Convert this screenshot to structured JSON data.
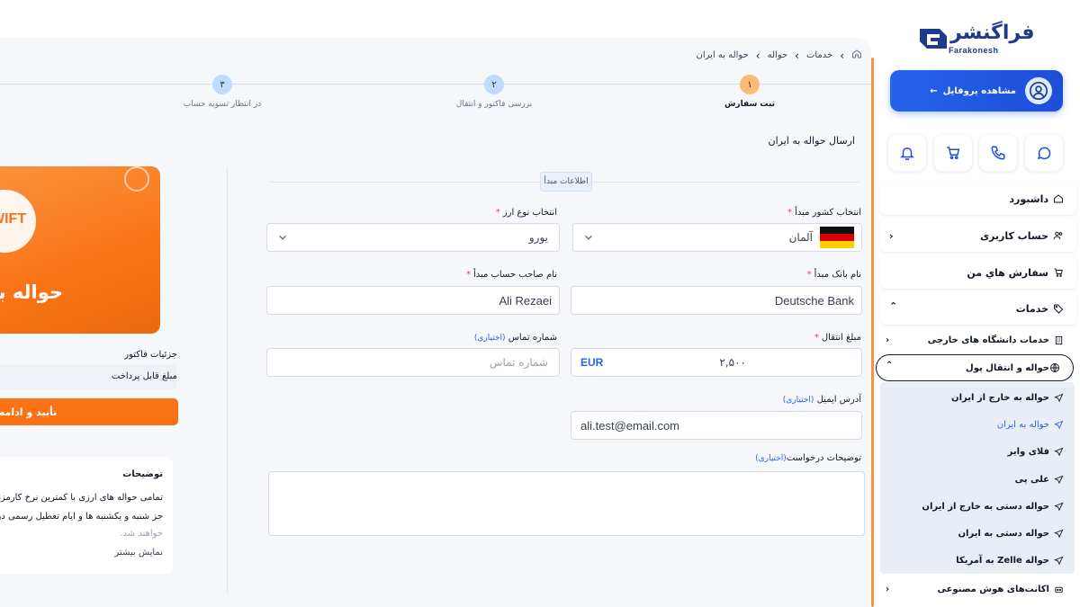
{
  "breadcrumb": {
    "home": "",
    "services": "خدمات",
    "remittance": "حواله",
    "current": "حواله به ایران"
  },
  "steps": [
    {
      "num": "۱",
      "label": "ثبت سفارش",
      "color": "#fdba74"
    },
    {
      "num": "۲",
      "label": "بررسی فاکتور و انتقال",
      "color": "#bfdbfe"
    },
    {
      "num": "۳",
      "label": "در انتظار تسویه حساب",
      "color": "#bfdbfe"
    }
  ],
  "form": {
    "title": "ارسال حواله به ایران",
    "section_label": "اطلاعات مبدأ",
    "origin_country_label": "انتخاب کشور مبدأ",
    "origin_country_value": "آلمان",
    "currency_label": "انتخاب نوع ارز",
    "currency_value": "یورو",
    "bank_label": "نام بانک مبدأ",
    "bank_value": "Deutsche Bank",
    "holder_label": "نام صاحب حساب مبدأ",
    "holder_value": "Ali Rezaei",
    "amount_label": "مبلغ انتقال",
    "amount_value": "۲,۵۰۰",
    "amount_currency": "EUR",
    "phone_label": "شماره تماس",
    "phone_optional": "(اختیاری)",
    "phone_placeholder": "شماره تماس",
    "email_label": "آدرس ایمیل",
    "email_optional": "(اختیاری)",
    "email_value": "ali.test@email.com",
    "notes_label": "توضیحات درخواست",
    "notes_optional": "(اختیاری)",
    "required_mark": "*"
  },
  "invoice": {
    "banner_swift": "WIFT",
    "banner_title": "حواله به",
    "details_label": "جزئیات فاکتور",
    "payable_label": "مبلغ قابل پرداخت",
    "confirm_button": "تأیید و ادامه پ",
    "desc_title": "توضیحات",
    "desc_line1": "تمامی حواله های ارزی با کمترین نرخ کارمزد د",
    "desc_line2": "جز شنبه و یکشنبه ها و ایام تعطیل رسمی در ا",
    "desc_line3": "خواهند شد.",
    "show_more": "نمایش بیشتر"
  },
  "sidebar": {
    "logo_text": "فراگنشر",
    "logo_sub": "Farakonesh",
    "profile_button": "مشاهده پروفایل",
    "quick_icons": [
      "bell-icon",
      "cart-icon",
      "phone-icon",
      "chat-icon"
    ],
    "items": {
      "dashboard": "داشبورد",
      "account": "حساب کاربری",
      "orders": "سفارش هاي من",
      "services": "خدمات",
      "universities": "خدمات دانشگاه های خارجی",
      "money_transfer": "حواله و انتقال پول",
      "ai_accounts": "اکانت‌های هوش مصنوعی"
    },
    "sub_items": [
      "حواله به خارج از ایران",
      "حواله به ایران",
      "فلای وایر",
      "علی پی",
      "حواله دستی به خارج از ایران",
      "حواله دستی به ایران",
      "حواله Zelle به آمریکا"
    ]
  },
  "colors": {
    "accent": "#2563eb",
    "orange": "#f97316",
    "required": "#ef4444"
  }
}
